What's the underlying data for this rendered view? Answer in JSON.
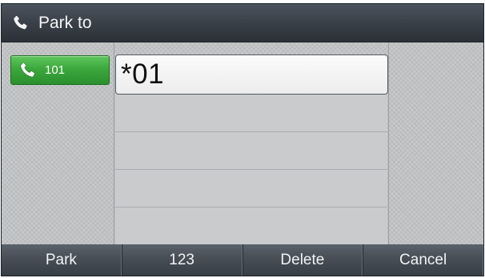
{
  "header": {
    "title": "Park to",
    "icon": "handset-icon"
  },
  "line_key": {
    "label": "101",
    "icon": "handset-icon",
    "color": "#3ca83d"
  },
  "input": {
    "value": "*01"
  },
  "softkeys": [
    {
      "label": "Park"
    },
    {
      "label": "123"
    },
    {
      "label": "Delete"
    },
    {
      "label": "Cancel"
    }
  ]
}
